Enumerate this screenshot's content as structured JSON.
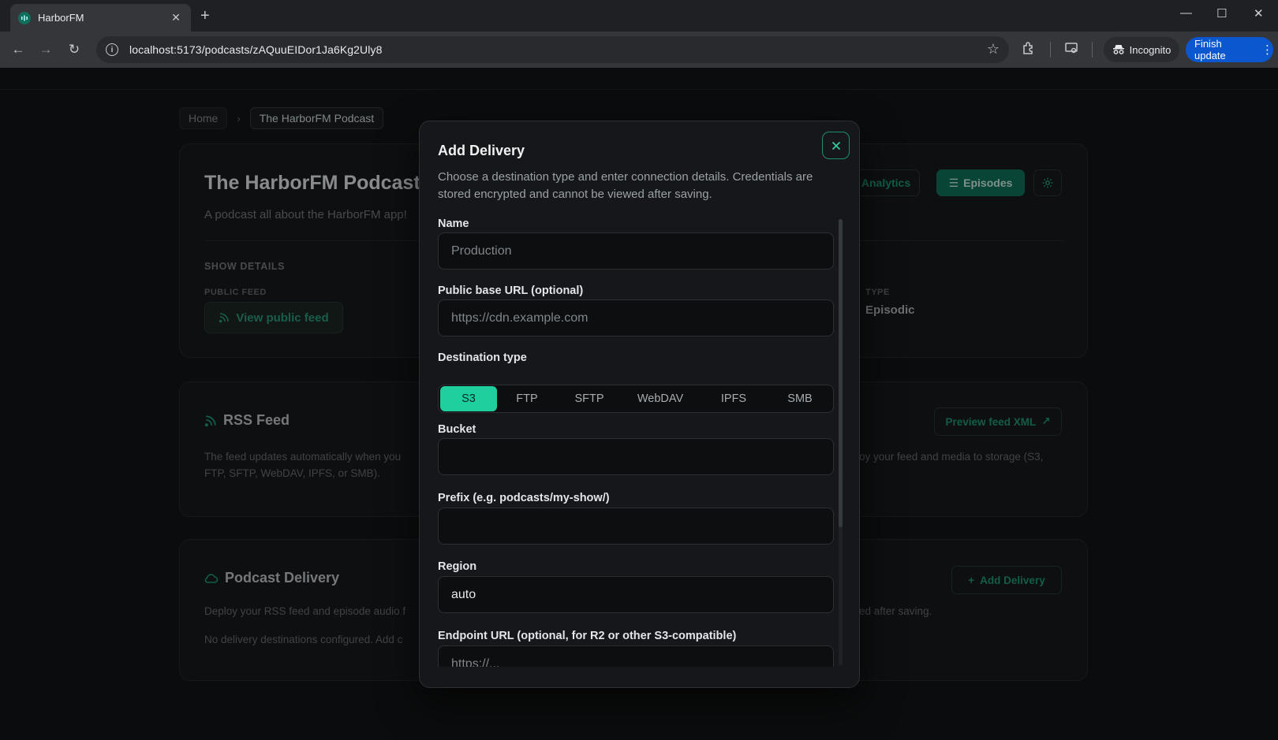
{
  "browser": {
    "tab_title": "HarborFM",
    "url": "localhost:5173/podcasts/zAQuuEIDor1Ja6Kg2Uly8",
    "incognito_label": "Incognito",
    "update_label": "Finish update"
  },
  "breadcrumb": {
    "home": "Home",
    "current": "The HarborFM Podcast"
  },
  "show": {
    "title": "The HarborFM Podcast",
    "description": "A podcast all about the HarborFM app!",
    "details_label": "SHOW DETAILS",
    "public_feed_label": "PUBLIC FEED",
    "view_feed_label": "View public feed",
    "type_label": "TYPE",
    "type_value": "Episodic",
    "analytics_label": "Analytics",
    "episodes_label": "Episodes"
  },
  "rss": {
    "title": "RSS Feed",
    "text_left_line1": "The feed updates automatically when you",
    "text_left_line2": "FTP, SFTP, WebDAV, IPFS, or SMB).",
    "text_right": "oy your feed and media to storage (S3,",
    "preview_label": "Preview feed XML"
  },
  "delivery": {
    "title": "Podcast Delivery",
    "text_left": "Deploy your RSS feed and episode audio f",
    "text_right": "ed after saving.",
    "empty_text": "No delivery destinations configured. Add c",
    "add_label": "Add Delivery"
  },
  "modal": {
    "title": "Add Delivery",
    "description": "Choose a destination type and enter connection details. Credentials are stored encrypted and cannot be viewed after saving.",
    "fields": {
      "name_label": "Name",
      "name_placeholder": "Production",
      "base_url_label": "Public base URL (optional)",
      "base_url_placeholder": "https://cdn.example.com",
      "dest_type_label": "Destination type",
      "bucket_label": "Bucket",
      "prefix_label": "Prefix (e.g. podcasts/my-show/)",
      "region_label": "Region",
      "region_value": "auto",
      "endpoint_label": "Endpoint URL (optional, for R2 or other S3-compatible)",
      "endpoint_placeholder": "https://..."
    },
    "destination_types": [
      "S3",
      "FTP",
      "SFTP",
      "WebDAV",
      "IPFS",
      "SMB"
    ],
    "selected_type": "S3"
  },
  "colors": {
    "accent": "#1fcf9e",
    "accent_dark": "#0f6b54",
    "background": "#111315",
    "modal_bg": "#15171a"
  }
}
